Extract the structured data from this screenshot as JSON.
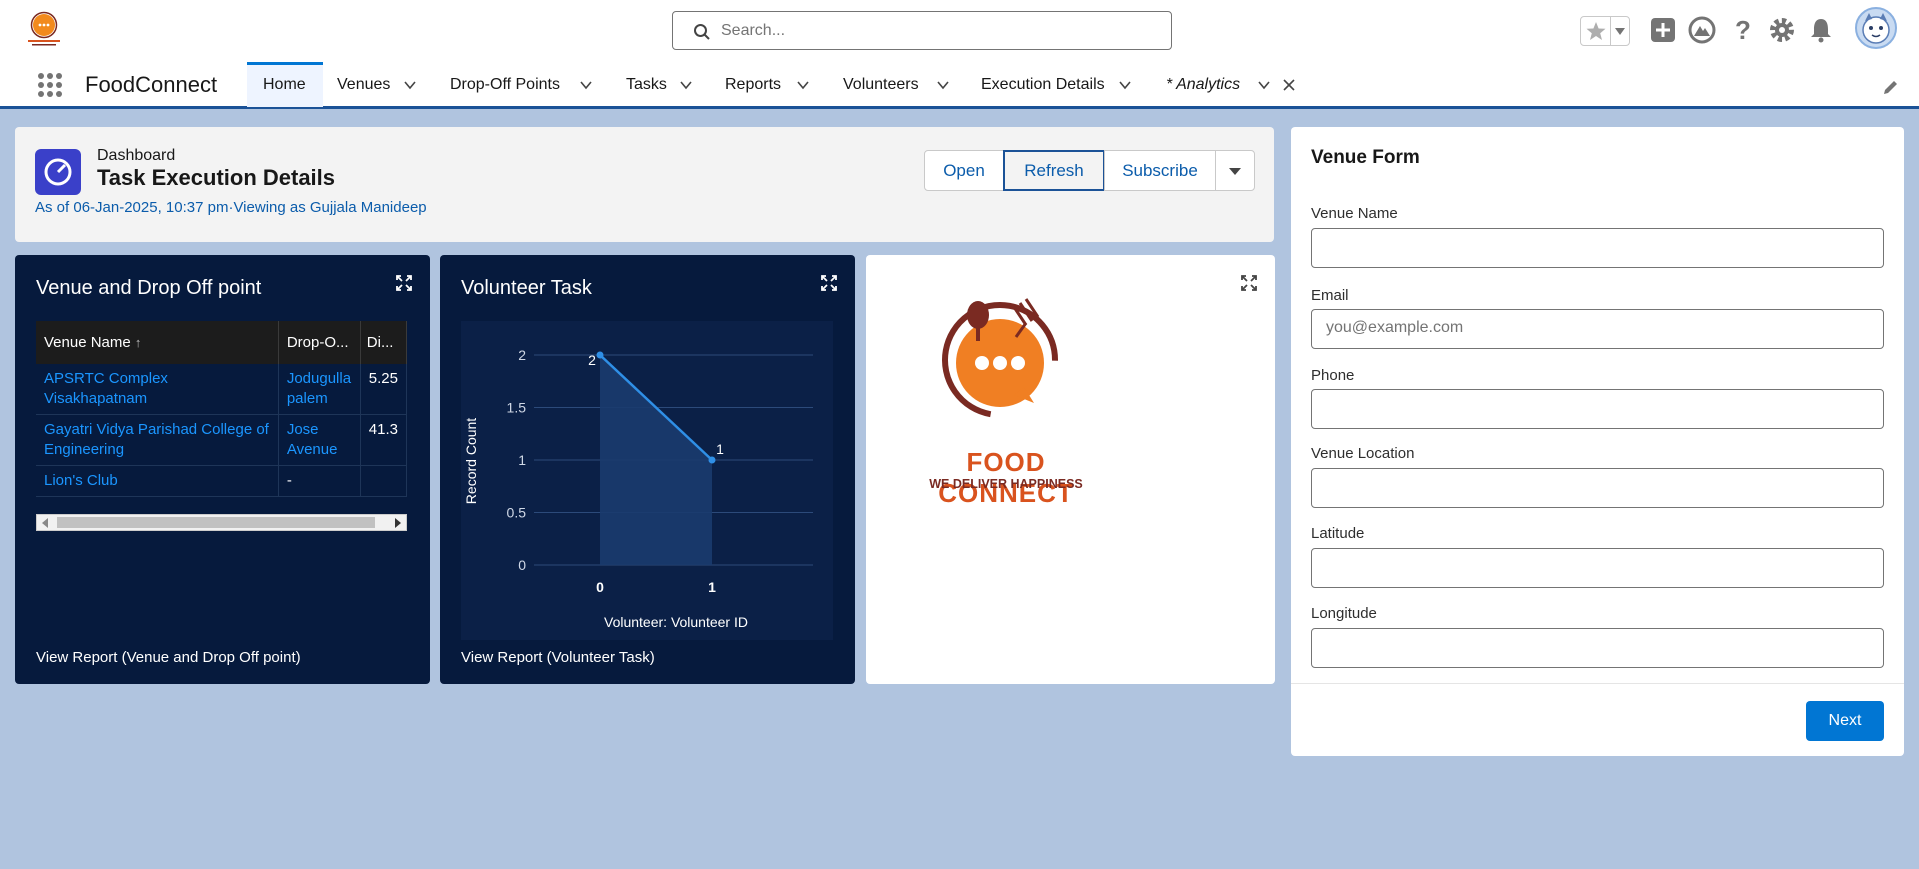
{
  "header": {
    "search_placeholder": "Search...",
    "icons": [
      "favorites-star-icon",
      "add-icon",
      "trailhead-icon",
      "help-icon",
      "setup-gear-icon",
      "notifications-bell-icon",
      "user-avatar"
    ]
  },
  "nav": {
    "app_name": "FoodConnect",
    "tabs": [
      {
        "label": "Home",
        "active": true
      },
      {
        "label": "Venues"
      },
      {
        "label": "Drop-Off Points"
      },
      {
        "label": "Tasks"
      },
      {
        "label": "Reports"
      },
      {
        "label": "Volunteers"
      },
      {
        "label": "Execution Details"
      },
      {
        "label": "* Analytics",
        "italic": true
      }
    ]
  },
  "dashboard": {
    "kind": "Dashboard",
    "title": "Task Execution Details",
    "subtitle": "As of 06-Jan-2025, 10:37 pm·Viewing as Gujjala Manideep",
    "buttons": {
      "open": "Open",
      "refresh": "Refresh",
      "subscribe": "Subscribe"
    }
  },
  "widget_venue": {
    "title": "Venue and Drop Off point",
    "columns": [
      "Venue Name",
      "Drop-O...",
      "Di..."
    ],
    "rows": [
      {
        "venue": "APSRTC Complex Visakhapatnam",
        "drop": "Jodugulla palem",
        "dist": "5.25"
      },
      {
        "venue": "Gayatri Vidya Parishad College of Engineering",
        "drop": "Jose Avenue",
        "dist": "41.3"
      },
      {
        "venue": "Lion's Club",
        "drop": "-",
        "dist": ""
      }
    ],
    "footer": "View Report (Venue and Drop Off point)"
  },
  "widget_volunteer": {
    "title": "Volunteer Task",
    "footer": "View Report (Volunteer Task)"
  },
  "chart_data": {
    "type": "area",
    "x": [
      0,
      1
    ],
    "values": [
      2,
      1
    ],
    "data_labels": [
      "2",
      "1"
    ],
    "xlabel": "Volunteer: Volunteer ID",
    "ylabel": "Record Count",
    "yticks": [
      "0",
      "0.5",
      "1",
      "1.5",
      "2"
    ],
    "xticks": [
      "0",
      "1"
    ],
    "ylim": [
      0,
      2
    ],
    "grid": true,
    "color": "#2f8fe6"
  },
  "logo_card": {
    "brand": "FOOD CONNECT",
    "tagline": "WE DELIVER HAPPINESS"
  },
  "venue_form": {
    "title": "Venue Form",
    "fields": [
      {
        "label": "Venue Name",
        "placeholder": ""
      },
      {
        "label": "Email",
        "placeholder": "you@example.com"
      },
      {
        "label": "Phone",
        "placeholder": ""
      },
      {
        "label": "Venue Location",
        "placeholder": ""
      },
      {
        "label": "Latitude",
        "placeholder": ""
      },
      {
        "label": "Longitude",
        "placeholder": ""
      }
    ],
    "next": "Next"
  },
  "colors": {
    "brand_blue": "#0176d3",
    "dark_widget": "#061a3d",
    "dashboard_bg": "#b0c4df"
  }
}
